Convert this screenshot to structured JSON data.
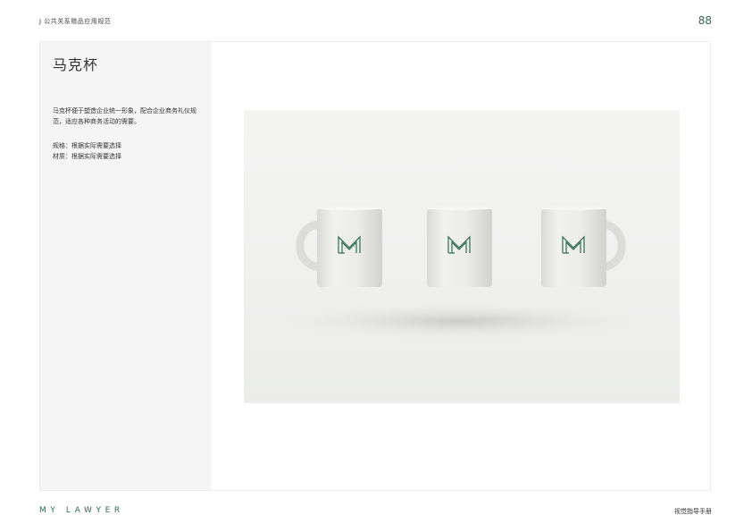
{
  "header": {
    "section_label": "J   公共关系赠品应用规范",
    "page_number": "88"
  },
  "content": {
    "title": "马克杯",
    "description": "马克杯便于塑造企业统一形象，配合企业商务礼仪规范，适应各种商务活动的需要。",
    "spec_size": "规格：根据实际需要选择",
    "spec_material": "材质：根据实际需要选择"
  },
  "image": {
    "mug_count": 3,
    "logo_color": "#2f6b55",
    "mug_color": "#e9eae6"
  },
  "footer": {
    "brand": "MY LAWYER",
    "manual_title": "视觉指导手册"
  }
}
